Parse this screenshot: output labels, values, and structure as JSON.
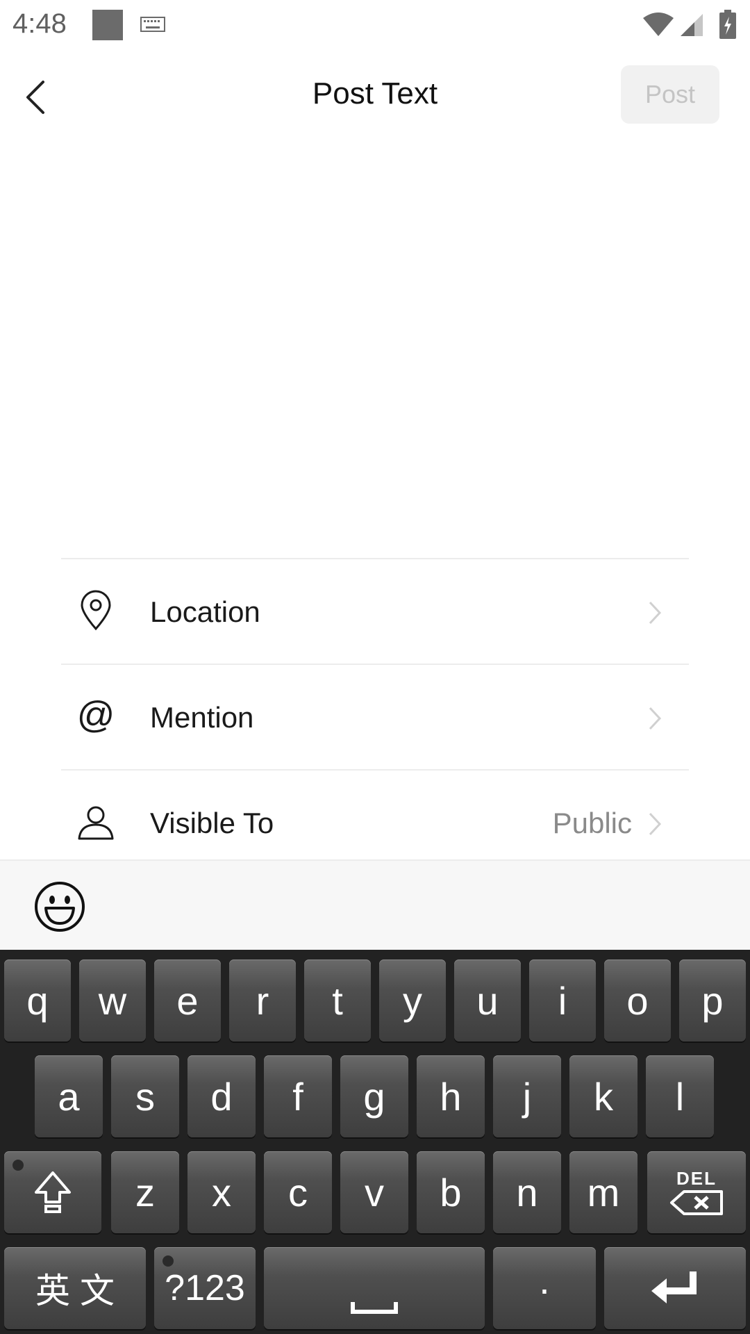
{
  "status_bar": {
    "time": "4:48"
  },
  "header": {
    "title": "Post Text",
    "post_label": "Post"
  },
  "options": [
    {
      "label": "Location",
      "value": ""
    },
    {
      "label": "Mention",
      "value": ""
    },
    {
      "label": "Visible To",
      "value": "Public"
    }
  ],
  "keyboard": {
    "row1": [
      "q",
      "w",
      "e",
      "r",
      "t",
      "y",
      "u",
      "i",
      "o",
      "p"
    ],
    "row2": [
      "a",
      "s",
      "d",
      "f",
      "g",
      "h",
      "j",
      "k",
      "l"
    ],
    "row3": [
      "z",
      "x",
      "c",
      "v",
      "b",
      "n",
      "m"
    ],
    "lang_label": "英 文",
    "symbols_label": "?123",
    "period_label": "·",
    "del_label": "DEL"
  }
}
